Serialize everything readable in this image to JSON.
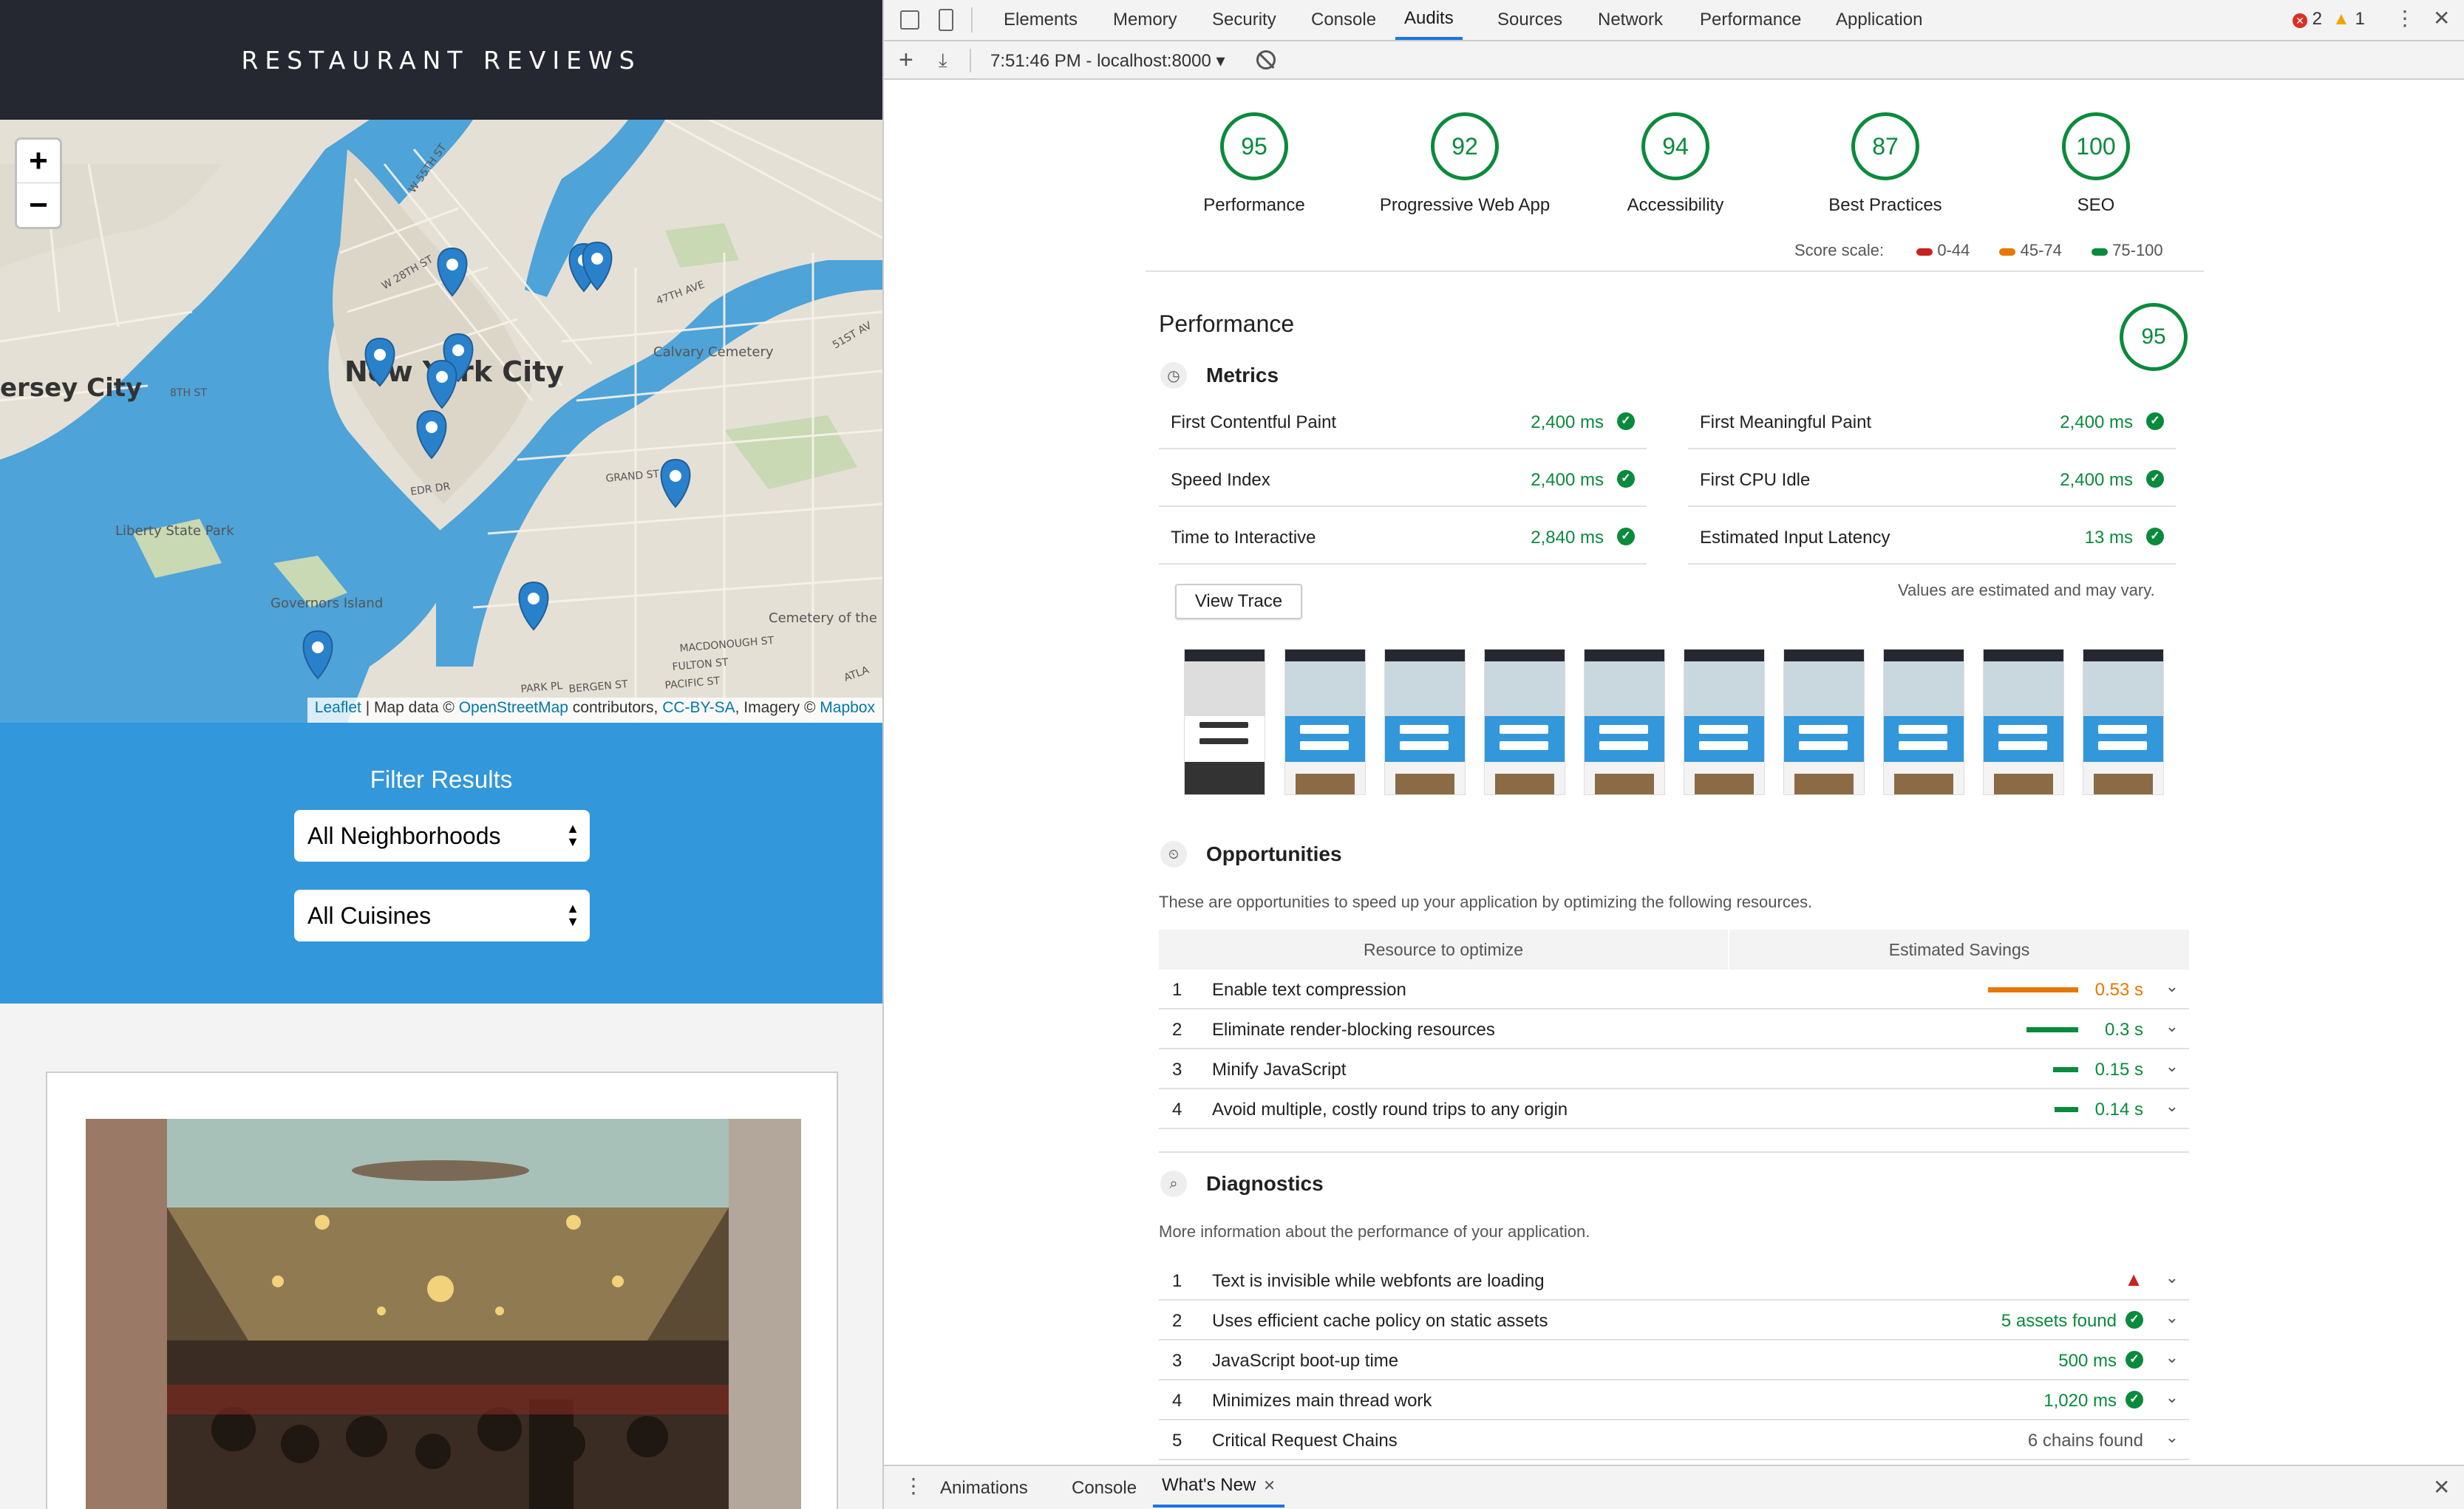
{
  "app": {
    "title": "RESTAURANT REVIEWS",
    "map": {
      "zoom_in": "+",
      "zoom_out": "−",
      "labels": [
        "ersey City",
        "New York City",
        "Liberty State Park",
        "Governors Island",
        "Calvary Cemetery",
        "Cemetery of the Evergreens",
        "W 55TH ST",
        "W 28TH ST",
        "47TH AVE",
        "GRAND ST",
        "FULTON ST",
        "PACIFIC ST",
        "BERGEN ST",
        "PARK PL",
        "MACDONOUGH ST",
        "EDR DR",
        "8TH ST",
        "51ST AV",
        "ATLA"
      ],
      "attribution": {
        "leaflet": "Leaflet",
        "sep1": " | Map data © ",
        "osm": "OpenStreetMap",
        "contrib": " contributors, ",
        "license": "CC-BY-SA",
        "imagery": ", Imagery © ",
        "mapbox": "Mapbox"
      }
    },
    "filter": {
      "title": "Filter Results",
      "neighborhood": "All Neighborhoods",
      "cuisine": "All Cuisines"
    }
  },
  "devtools": {
    "tabs": [
      "Elements",
      "Memory",
      "Security",
      "Console",
      "Audits",
      "Sources",
      "Network",
      "Performance",
      "Application"
    ],
    "active_tab": "Audits",
    "errors": "2",
    "warnings": "1",
    "toolbar": {
      "report": "7:51:46 PM - localhost:8000 ▾"
    },
    "gauges": [
      {
        "score": "95",
        "label": "Performance"
      },
      {
        "score": "92",
        "label": "Progressive Web App"
      },
      {
        "score": "94",
        "label": "Accessibility"
      },
      {
        "score": "87",
        "label": "Best Practices"
      },
      {
        "score": "100",
        "label": "SEO"
      }
    ],
    "scale": {
      "label": "Score scale:",
      "low": "0-44",
      "mid": "45-74",
      "high": "75-100"
    },
    "colors": {
      "pass": "#0a8a3d",
      "average": "#e67700",
      "fail": "#c7221f",
      "accent": "#1a73e8"
    },
    "performance": {
      "title": "Performance",
      "score": "95",
      "metrics_title": "Metrics",
      "metrics": [
        {
          "name": "First Contentful Paint",
          "value": "2,400 ms"
        },
        {
          "name": "First Meaningful Paint",
          "value": "2,400 ms"
        },
        {
          "name": "Speed Index",
          "value": "2,400 ms"
        },
        {
          "name": "First CPU Idle",
          "value": "2,400 ms"
        },
        {
          "name": "Time to Interactive",
          "value": "2,840 ms"
        },
        {
          "name": "Estimated Input Latency",
          "value": "13 ms"
        }
      ],
      "view_trace": "View Trace",
      "note": "Values are estimated and may vary.",
      "opportunities": {
        "title": "Opportunities",
        "desc": "These are opportunities to speed up your application by optimizing the following resources.",
        "col1": "Resource to optimize",
        "col2": "Estimated Savings",
        "rows": [
          {
            "idx": "1",
            "name": "Enable text compression",
            "value": "0.53 s",
            "fraction": 1.0,
            "color": "#e67700"
          },
          {
            "idx": "2",
            "name": "Eliminate render-blocking resources",
            "value": "0.3 s",
            "fraction": 0.57,
            "color": "#0a8a3d"
          },
          {
            "idx": "3",
            "name": "Minify JavaScript",
            "value": "0.15 s",
            "fraction": 0.28,
            "color": "#0a8a3d"
          },
          {
            "idx": "4",
            "name": "Avoid multiple, costly round trips to any origin",
            "value": "0.14 s",
            "fraction": 0.26,
            "color": "#0a8a3d"
          }
        ]
      },
      "diagnostics": {
        "title": "Diagnostics",
        "desc": "More information about the performance of your application.",
        "rows": [
          {
            "idx": "1",
            "name": "Text is invisible while webfonts are loading",
            "value": ""
          },
          {
            "idx": "2",
            "name": "Uses efficient cache policy on static assets",
            "value": "5 assets found"
          },
          {
            "idx": "3",
            "name": "JavaScript boot-up time",
            "value": "500 ms"
          },
          {
            "idx": "4",
            "name": "Minimizes main thread work",
            "value": "1,020 ms"
          },
          {
            "idx": "5",
            "name": "Critical Request Chains",
            "value": "6 chains found"
          }
        ]
      }
    },
    "drawer": {
      "tabs": [
        "Animations",
        "Console",
        "What's New"
      ]
    }
  }
}
